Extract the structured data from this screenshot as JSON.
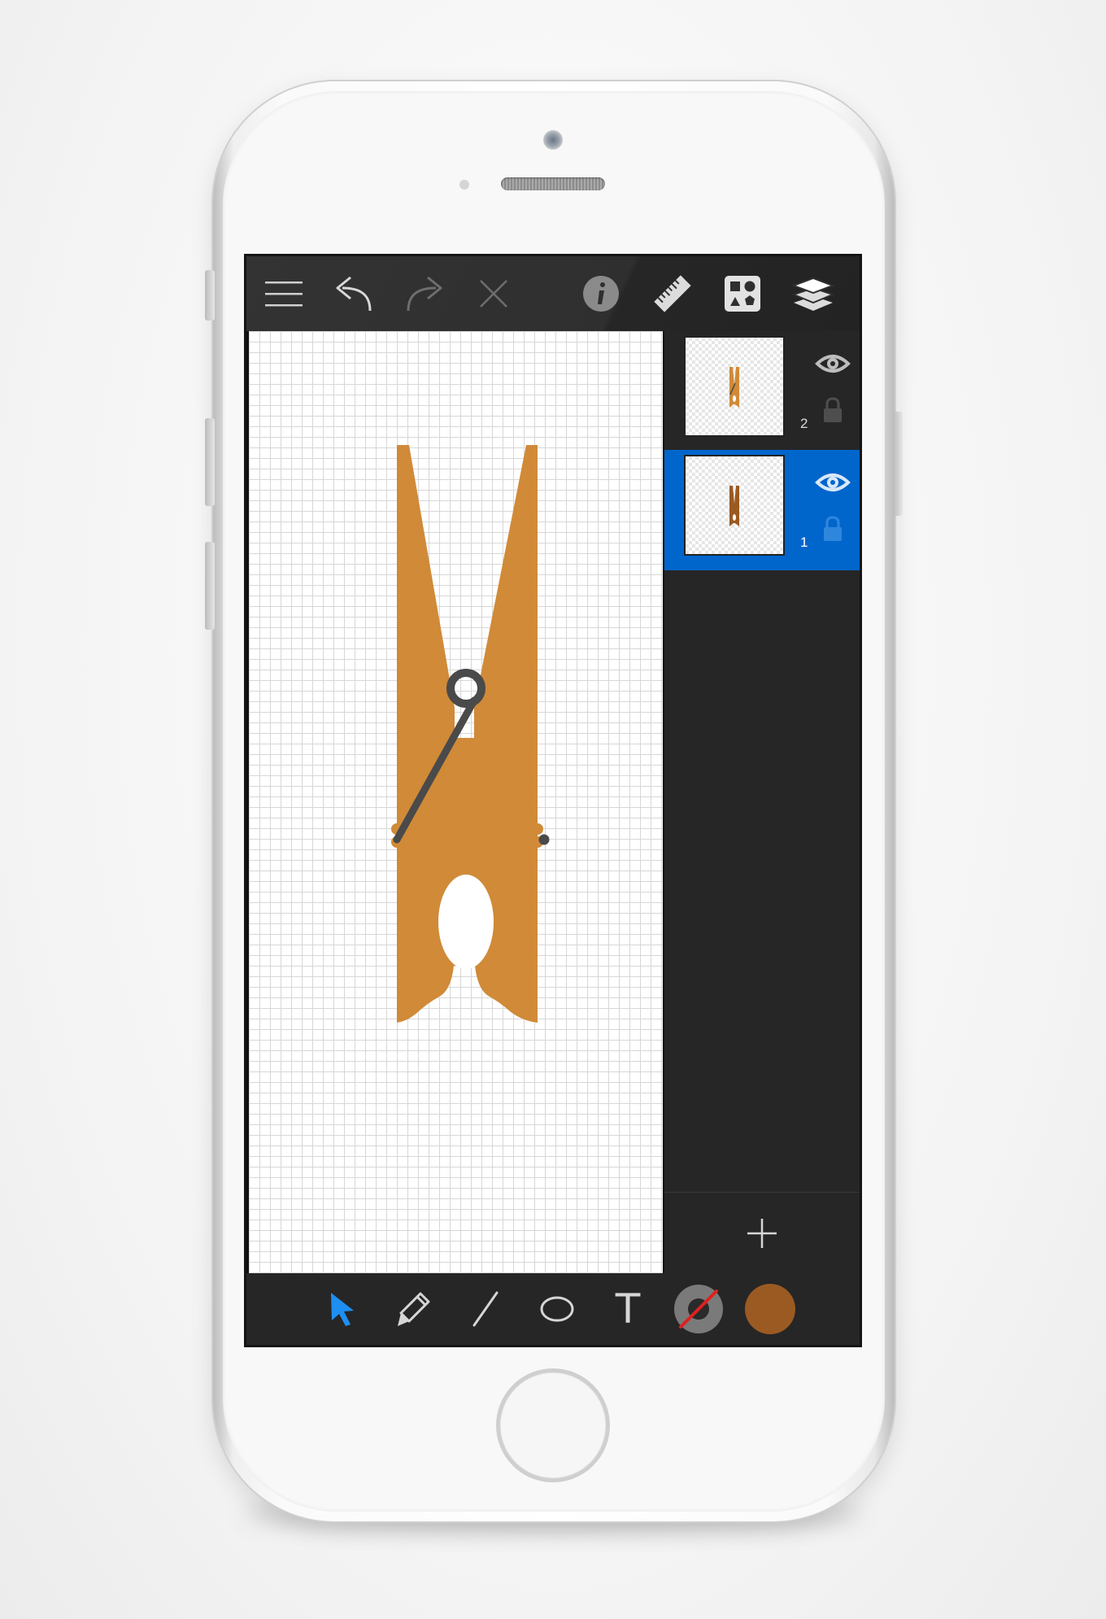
{
  "device": {
    "name": "smartphone",
    "frame_color": "#f8f8f8"
  },
  "app": {
    "toolbar": {
      "menu_icon": "hamburger-menu-icon",
      "undo_icon": "undo-icon",
      "redo_icon": "redo-icon",
      "delete_icon": "close-icon",
      "info_icon": "info-icon",
      "ruler_icon": "ruler-icon",
      "shapes_icon": "shapes-icon",
      "layers_icon": "layers-icon",
      "redo_enabled": false,
      "delete_enabled": false
    },
    "canvas": {
      "grid": true,
      "object": "clothespin",
      "fill_color": "#d08a38",
      "stroke_color": "#4a4a4a"
    },
    "layers_panel": {
      "layers": [
        {
          "number": "2",
          "visible": true,
          "locked": false,
          "selected": false
        },
        {
          "number": "1",
          "visible": true,
          "locked": false,
          "selected": true
        }
      ],
      "add_icon": "plus-icon",
      "selected_color": "#0066cc"
    },
    "bottom_toolbar": {
      "tools": [
        {
          "id": "select",
          "icon": "arrow-cursor-icon",
          "active": true
        },
        {
          "id": "pencil",
          "icon": "pencil-icon",
          "active": false
        },
        {
          "id": "line",
          "icon": "line-icon",
          "active": false
        },
        {
          "id": "ellipse",
          "icon": "ellipse-icon",
          "active": false
        },
        {
          "id": "text",
          "icon": "text-icon",
          "glyph": "T",
          "active": false
        }
      ],
      "stroke_color_icon": "stroke-color-icon",
      "fill_color_icon": "fill-color-icon",
      "fill_color": "#9b5a22",
      "accent_color": "#1e8ff0"
    }
  }
}
